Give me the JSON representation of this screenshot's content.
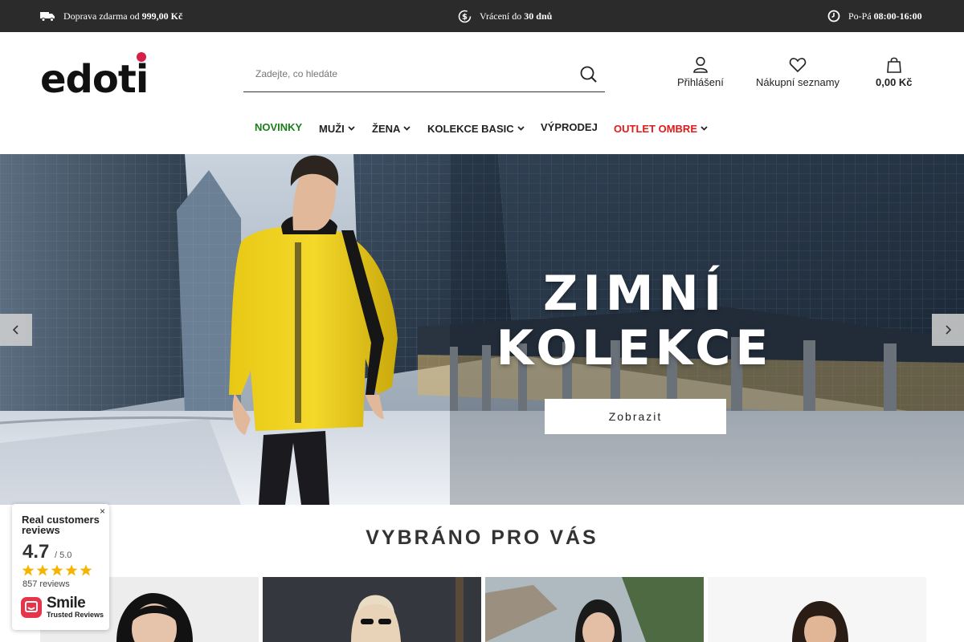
{
  "topbar": {
    "shipping_text": "Doprava zdarma od",
    "shipping_value": "999,00 Kč",
    "returns_text": "Vrácení do",
    "returns_value": "30 dnů",
    "hours_text": "Po-Pá",
    "hours_value": "08:00-16:00"
  },
  "header": {
    "logo_text": "edoti",
    "search_placeholder": "Zadejte, co hledáte",
    "login_label": "Přihlášení",
    "wishlist_label": "Nákupní seznamy",
    "cart_label": "0,00 Kč"
  },
  "nav": {
    "items": [
      {
        "label": "NOVINKY",
        "color": "#1a7f1a"
      },
      {
        "label": "MUŽI"
      },
      {
        "label": "ŽENA"
      },
      {
        "label": "KOLEKCE BASIC"
      },
      {
        "label": "VÝPRODEJ"
      },
      {
        "label": "OUTLET OMBRE",
        "color": "#e01a1a"
      }
    ]
  },
  "hero": {
    "title_line1": "ZIMNÍ",
    "title_line2": "KOLEKCE",
    "cta_label": "Zobrazit"
  },
  "section": {
    "title": "VYBRÁNO PRO VÁS"
  },
  "reviews_widget": {
    "title": "Real customers reviews",
    "score": "4.7",
    "out_of": "/ 5.0",
    "rating": 4.7,
    "count": "857 reviews",
    "brand": "Smile",
    "brand_sub": "Trusted Reviews",
    "close": "×"
  },
  "colors": {
    "topbar_bg": "#2b2b2b",
    "logo_dot": "#d6204a",
    "new_color": "#1a7f1a",
    "outlet_color": "#e01a1a",
    "star_color": "#f5b400",
    "brand_badge": "#e8344a"
  }
}
